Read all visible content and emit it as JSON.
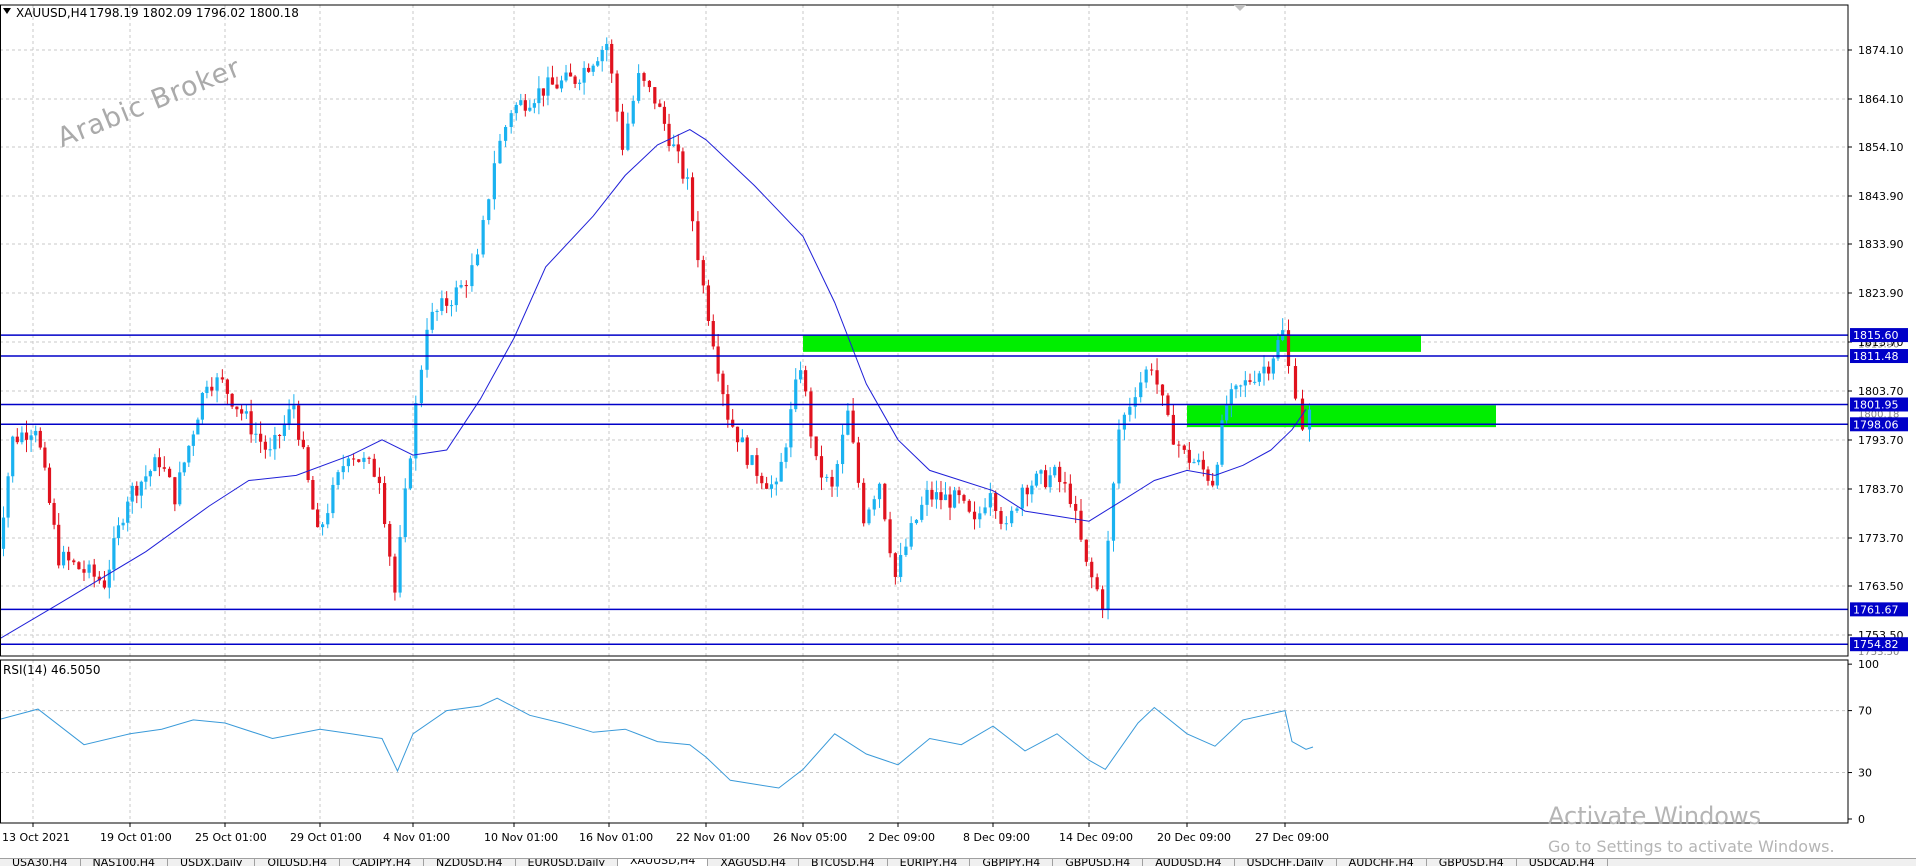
{
  "header": {
    "symbol": "XAUUSD,H4",
    "ohlc": "1798.19 1802.09 1796.02 1800.18",
    "menu_icon": "triangle-down-icon"
  },
  "watermark": "Arabic Broker",
  "activation": {
    "line1": "Activate Windows",
    "line2": "Go to Settings to activate Windows."
  },
  "colors": {
    "bull": "#1ab2f0",
    "bear": "#e0121e",
    "ma": "#2020d8",
    "level": "#0000c8",
    "zone": "#00ee00",
    "rsi": "#3a9ad9",
    "grid": "#c8c8c8"
  },
  "chart_data": [
    {
      "type": "candlestick",
      "title": "",
      "indicator": "moving average",
      "ylim": [
        1752.5,
        1880.5
      ],
      "yticks": [
        "1874.10",
        "1864.10",
        "1854.10",
        "1843.90",
        "1833.90",
        "1823.90",
        "1813.70",
        "1803.70",
        "1793.70",
        "1783.70",
        "1773.70",
        "1763.50",
        "1753.50"
      ],
      "xticks": [
        "13 Oct 2021",
        "19 Oct 01:00",
        "25 Oct 01:00",
        "29 Oct 01:00",
        "4 Nov 01:00",
        "10 Nov 01:00",
        "16 Nov 01:00",
        "22 Nov 01:00",
        "26 Nov 05:00",
        "2 Dec 09:00",
        "8 Dec 09:00",
        "14 Dec 09:00",
        "20 Dec 09:00",
        "27 Dec 09:00"
      ],
      "current_price": 1800.18,
      "levels": [
        {
          "price": 1815.6,
          "label": "1815.60"
        },
        {
          "price": 1811.48,
          "label": "1811.48"
        },
        {
          "price": 1801.95,
          "label": "1801.95"
        },
        {
          "price": 1798.06,
          "label": "1798.06"
        },
        {
          "price": 1761.67,
          "label": "1761.67"
        },
        {
          "price": 1754.82,
          "label": "1754.82"
        }
      ],
      "hidden_labels": [
        "1813.90",
        "1800.18",
        "1753.50"
      ],
      "zones": [
        {
          "from_date": "26 Nov",
          "to_date": "end",
          "top": 1815.6,
          "bottom": 1812.3
        },
        {
          "from_date": "20 Dec",
          "to_date": "end",
          "top": 1801.8,
          "bottom": 1797.5
        }
      ],
      "price_path": [
        {
          "date": "13 Oct",
          "price": 1761
        },
        {
          "date": "14 Oct",
          "price": 1795
        },
        {
          "date": "15 Oct",
          "price": 1798
        },
        {
          "date": "16 Oct",
          "price": 1772
        },
        {
          "date": "18 Oct",
          "price": 1767
        },
        {
          "date": "19 Oct",
          "price": 1784
        },
        {
          "date": "21 Oct",
          "price": 1791
        },
        {
          "date": "22 Oct",
          "price": 1784
        },
        {
          "date": "24 Oct",
          "price": 1807
        },
        {
          "date": "25 Oct",
          "price": 1806
        },
        {
          "date": "27 Oct",
          "price": 1792
        },
        {
          "date": "28 Oct",
          "price": 1802
        },
        {
          "date": "29 Oct",
          "price": 1776
        },
        {
          "date": "31 Oct",
          "price": 1793
        },
        {
          "date": "2 Nov",
          "price": 1788
        },
        {
          "date": "3 Nov",
          "price": 1765
        },
        {
          "date": "4 Nov",
          "price": 1793
        },
        {
          "date": "5 Nov",
          "price": 1818
        },
        {
          "date": "7 Nov",
          "price": 1825
        },
        {
          "date": "8 Nov",
          "price": 1830
        },
        {
          "date": "9 Nov",
          "price": 1850
        },
        {
          "date": "10 Nov",
          "price": 1860
        },
        {
          "date": "12 Nov",
          "price": 1864
        },
        {
          "date": "14 Nov",
          "price": 1866
        },
        {
          "date": "16 Nov",
          "price": 1873
        },
        {
          "date": "17 Nov",
          "price": 1853
        },
        {
          "date": "18 Nov",
          "price": 1866
        },
        {
          "date": "19 Nov",
          "price": 1862
        },
        {
          "date": "21 Nov",
          "price": 1845
        },
        {
          "date": "22 Nov",
          "price": 1825
        },
        {
          "date": "23 Nov",
          "price": 1800
        },
        {
          "date": "24 Nov",
          "price": 1790
        },
        {
          "date": "25 Nov",
          "price": 1785
        },
        {
          "date": "26 Nov",
          "price": 1810
        },
        {
          "date": "27 Nov",
          "price": 1790
        },
        {
          "date": "28 Nov",
          "price": 1785
        },
        {
          "date": "29 Nov",
          "price": 1800
        },
        {
          "date": "30 Nov",
          "price": 1780
        },
        {
          "date": "1 Dec",
          "price": 1787
        },
        {
          "date": "2 Dec",
          "price": 1768
        },
        {
          "date": "3 Dec",
          "price": 1777
        },
        {
          "date": "4 Dec",
          "price": 1784
        },
        {
          "date": "6 Dec",
          "price": 1783
        },
        {
          "date": "7 Dec",
          "price": 1778
        },
        {
          "date": "8 Dec",
          "price": 1786
        },
        {
          "date": "9 Dec",
          "price": 1777
        },
        {
          "date": "10 Dec",
          "price": 1786
        },
        {
          "date": "12 Dec",
          "price": 1788
        },
        {
          "date": "13 Dec",
          "price": 1784
        },
        {
          "date": "14 Dec",
          "price": 1770
        },
        {
          "date": "15 Dec",
          "price": 1763
        },
        {
          "date": "16 Dec",
          "price": 1797
        },
        {
          "date": "17 Dec",
          "price": 1805
        },
        {
          "date": "18 Dec",
          "price": 1810
        },
        {
          "date": "19 Dec",
          "price": 1798
        },
        {
          "date": "20 Dec",
          "price": 1792
        },
        {
          "date": "21 Dec",
          "price": 1790
        },
        {
          "date": "22 Dec",
          "price": 1787
        },
        {
          "date": "23 Dec",
          "price": 1802
        },
        {
          "date": "25 Dec",
          "price": 1808
        },
        {
          "date": "26 Dec",
          "price": 1810
        },
        {
          "date": "27 Dec",
          "price": 1816
        },
        {
          "date": "28 Dec",
          "price": 1809
        },
        {
          "date": "29 Dec",
          "price": 1805
        },
        {
          "date": "30 Dec",
          "price": 1798
        },
        {
          "date": "31 Dec",
          "price": 1800
        }
      ],
      "ma_path": [
        {
          "date": "13 Oct",
          "price": 1755
        },
        {
          "date": "16 Oct",
          "price": 1763
        },
        {
          "date": "20 Oct",
          "price": 1773
        },
        {
          "date": "24 Oct",
          "price": 1782
        },
        {
          "date": "26 Oct",
          "price": 1787
        },
        {
          "date": "28 Oct",
          "price": 1788
        },
        {
          "date": "31 Oct",
          "price": 1792
        },
        {
          "date": "2 Nov",
          "price": 1795
        },
        {
          "date": "4 Nov",
          "price": 1792
        },
        {
          "date": "6 Nov",
          "price": 1793
        },
        {
          "date": "8 Nov",
          "price": 1803
        },
        {
          "date": "10 Nov",
          "price": 1815
        },
        {
          "date": "12 Nov",
          "price": 1829
        },
        {
          "date": "15 Nov",
          "price": 1839
        },
        {
          "date": "17 Nov",
          "price": 1847
        },
        {
          "date": "19 Nov",
          "price": 1853
        },
        {
          "date": "21 Nov",
          "price": 1856
        },
        {
          "date": "22 Nov",
          "price": 1854
        },
        {
          "date": "24 Nov",
          "price": 1845
        },
        {
          "date": "26 Nov",
          "price": 1835
        },
        {
          "date": "28 Nov",
          "price": 1822
        },
        {
          "date": "30 Nov",
          "price": 1806
        },
        {
          "date": "2 Dec",
          "price": 1795
        },
        {
          "date": "4 Dec",
          "price": 1789
        },
        {
          "date": "6 Dec",
          "price": 1787
        },
        {
          "date": "8 Dec",
          "price": 1785
        },
        {
          "date": "10 Dec",
          "price": 1781
        },
        {
          "date": "12 Dec",
          "price": 1780
        },
        {
          "date": "14 Dec",
          "price": 1779
        },
        {
          "date": "16 Dec",
          "price": 1783
        },
        {
          "date": "18 Dec",
          "price": 1787
        },
        {
          "date": "20 Dec",
          "price": 1789
        },
        {
          "date": "22 Dec",
          "price": 1788
        },
        {
          "date": "24 Dec",
          "price": 1790
        },
        {
          "date": "26 Dec",
          "price": 1793
        },
        {
          "date": "28 Dec",
          "price": 1797
        },
        {
          "date": "30 Dec",
          "price": 1801
        }
      ]
    },
    {
      "type": "line",
      "title": "RSI(14) 46.5050",
      "ylim": [
        0,
        100
      ],
      "yticks": [
        "100",
        "70",
        "30",
        "0"
      ],
      "path": [
        {
          "date": "13 Oct",
          "rsi": 63
        },
        {
          "date": "15 Oct",
          "rsi": 71
        },
        {
          "date": "17 Oct",
          "rsi": 48
        },
        {
          "date": "19 Oct",
          "rsi": 55
        },
        {
          "date": "21 Oct",
          "rsi": 58
        },
        {
          "date": "23 Oct",
          "rsi": 64
        },
        {
          "date": "25 Oct",
          "rsi": 62
        },
        {
          "date": "27 Oct",
          "rsi": 52
        },
        {
          "date": "29 Oct",
          "rsi": 58
        },
        {
          "date": "31 Oct",
          "rsi": 55
        },
        {
          "date": "2 Nov",
          "rsi": 52
        },
        {
          "date": "3 Nov",
          "rsi": 31
        },
        {
          "date": "4 Nov",
          "rsi": 55
        },
        {
          "date": "6 Nov",
          "rsi": 70
        },
        {
          "date": "8 Nov",
          "rsi": 73
        },
        {
          "date": "9 Nov",
          "rsi": 78
        },
        {
          "date": "11 Nov",
          "rsi": 67
        },
        {
          "date": "13 Nov",
          "rsi": 62
        },
        {
          "date": "15 Nov",
          "rsi": 56
        },
        {
          "date": "17 Nov",
          "rsi": 58
        },
        {
          "date": "19 Nov",
          "rsi": 50
        },
        {
          "date": "21 Nov",
          "rsi": 48
        },
        {
          "date": "22 Nov",
          "rsi": 40
        },
        {
          "date": "23 Nov",
          "rsi": 25
        },
        {
          "date": "25 Nov",
          "rsi": 20
        },
        {
          "date": "26 Nov",
          "rsi": 32
        },
        {
          "date": "28 Nov",
          "rsi": 55
        },
        {
          "date": "30 Nov",
          "rsi": 42
        },
        {
          "date": "2 Dec",
          "rsi": 35
        },
        {
          "date": "4 Dec",
          "rsi": 52
        },
        {
          "date": "6 Dec",
          "rsi": 48
        },
        {
          "date": "8 Dec",
          "rsi": 60
        },
        {
          "date": "10 Dec",
          "rsi": 44
        },
        {
          "date": "12 Dec",
          "rsi": 55
        },
        {
          "date": "14 Dec",
          "rsi": 38
        },
        {
          "date": "15 Dec",
          "rsi": 32
        },
        {
          "date": "17 Dec",
          "rsi": 62
        },
        {
          "date": "18 Dec",
          "rsi": 72
        },
        {
          "date": "20 Dec",
          "rsi": 55
        },
        {
          "date": "22 Dec",
          "rsi": 47
        },
        {
          "date": "24 Dec",
          "rsi": 64
        },
        {
          "date": "26 Dec",
          "rsi": 68
        },
        {
          "date": "27 Dec",
          "rsi": 70
        },
        {
          "date": "28 Dec",
          "rsi": 50
        },
        {
          "date": "30 Dec",
          "rsi": 45
        },
        {
          "date": "31 Dec",
          "rsi": 46.5
        }
      ]
    }
  ],
  "tabs": [
    {
      "label": "USA30,H4",
      "active": false
    },
    {
      "label": "NAS100,H4",
      "active": false
    },
    {
      "label": "USDX,Daily",
      "active": false
    },
    {
      "label": "OILUSD,H4",
      "active": false
    },
    {
      "label": "CADJPY,H4",
      "active": false
    },
    {
      "label": "NZDUSD,H4",
      "active": false
    },
    {
      "label": "EURUSD,Daily",
      "active": false
    },
    {
      "label": "XAUUSD,H4",
      "active": true
    },
    {
      "label": "XAGUSD,H4",
      "active": false
    },
    {
      "label": "BTCUSD,H4",
      "active": false
    },
    {
      "label": "EURJPY,H4",
      "active": false
    },
    {
      "label": "GBPJPY,H4",
      "active": false
    },
    {
      "label": "GBPUSD,H4",
      "active": false
    },
    {
      "label": "AUDUSD,H4",
      "active": false
    },
    {
      "label": "USDCHF,Daily",
      "active": false
    },
    {
      "label": "AUDCHF,H4",
      "active": false
    },
    {
      "label": "GBPUSD,H4",
      "active": false
    },
    {
      "label": "USDCAD,H4",
      "active": false
    }
  ]
}
